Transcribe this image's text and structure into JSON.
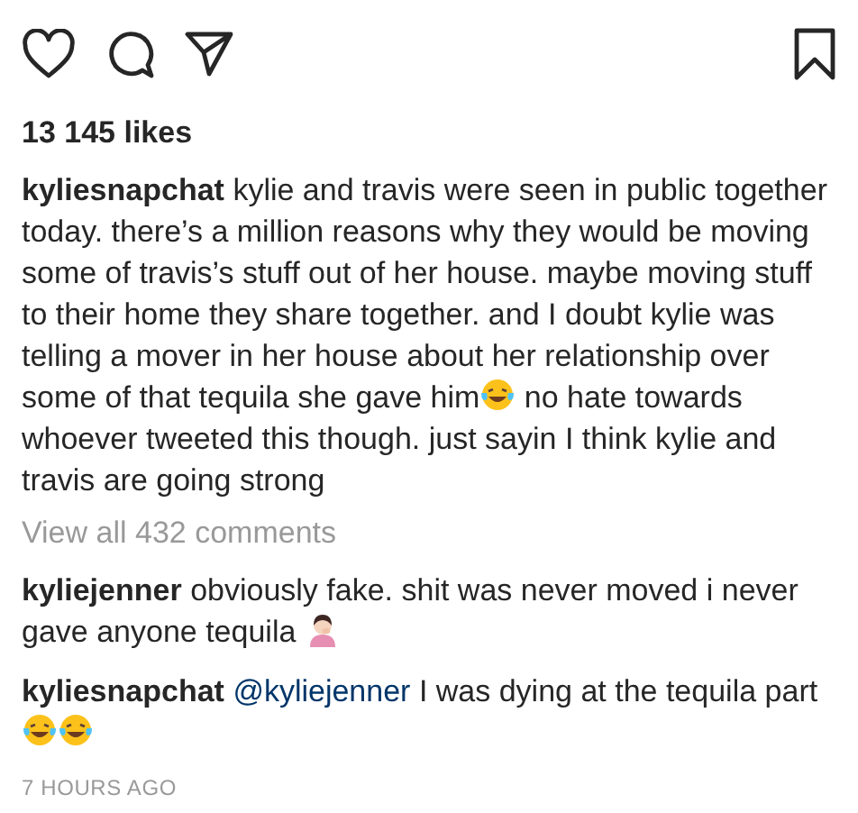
{
  "likes": "13 145 likes",
  "caption": {
    "username": "kyliesnapchat",
    "segments": [
      {
        "kind": "text",
        "text": "kylie and travis were seen in public together today. there’s a million reasons why they would be moving some of travis’s stuff out of her house. maybe moving stuff to their home they share together. and I doubt kylie was telling a mover in her house about her relationship over some of that tequila she gave him"
      },
      {
        "kind": "laugh"
      },
      {
        "kind": "text",
        "text": " no hate towards whoever tweeted this though. just sayin I think kylie and travis are going strong"
      }
    ]
  },
  "view_all": "View all 432 comments",
  "comments": [
    {
      "username": "kyliejenner",
      "segments": [
        {
          "kind": "text",
          "text": "obviously fake. shit was never moved i never gave anyone tequila "
        },
        {
          "kind": "facepalm"
        }
      ]
    },
    {
      "username": "kyliesnapchat",
      "segments": [
        {
          "kind": "mention",
          "text": "@kyliejenner"
        },
        {
          "kind": "text",
          "text": " I was dying at the tequila part"
        },
        {
          "kind": "laugh"
        },
        {
          "kind": "laugh"
        }
      ]
    }
  ],
  "time": "7 HOURS AGO"
}
